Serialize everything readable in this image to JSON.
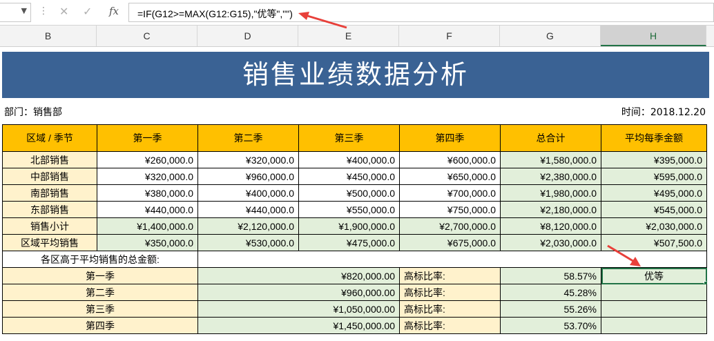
{
  "formula_bar": {
    "formula": "=IF(G12>=MAX(G12:G15),\"优等\",\"\")",
    "fx_label": "fx"
  },
  "columns": [
    "B",
    "C",
    "D",
    "E",
    "F",
    "G",
    "H"
  ],
  "sheet": {
    "title": "销售业绩数据分析",
    "department": "部门：销售部",
    "time": "时间：2018.12.20",
    "headers": [
      "区域 / 季节",
      "第一季",
      "第二季",
      "第三季",
      "第四季",
      "总合计",
      "平均每季金额"
    ],
    "rows": [
      [
        "北部销售",
        "¥260,000.0",
        "¥320,000.0",
        "¥400,000.0",
        "¥600,000.0",
        "¥1,580,000.0",
        "¥395,000.0"
      ],
      [
        "中部销售",
        "¥320,000.0",
        "¥960,000.0",
        "¥450,000.0",
        "¥650,000.0",
        "¥2,380,000.0",
        "¥595,000.0"
      ],
      [
        "南部销售",
        "¥380,000.0",
        "¥400,000.0",
        "¥500,000.0",
        "¥700,000.0",
        "¥1,980,000.0",
        "¥495,000.0"
      ],
      [
        "东部销售",
        "¥440,000.0",
        "¥440,000.0",
        "¥550,000.0",
        "¥750,000.0",
        "¥2,180,000.0",
        "¥545,000.0"
      ],
      [
        "销售小计",
        "¥1,400,000.0",
        "¥2,120,000.0",
        "¥1,900,000.0",
        "¥2,700,000.0",
        "¥8,120,000.0",
        "¥2,030,000.0"
      ],
      [
        "区域平均销售",
        "¥350,000.0",
        "¥530,000.0",
        "¥475,000.0",
        "¥675,000.0",
        "¥2,030,000.0",
        "¥507,500.0"
      ]
    ],
    "above_avg_label": "各区高于平均销售的总金额:",
    "quarters": [
      {
        "name": "第一季",
        "amount": "¥820,000.00",
        "ratio_label": "高标比率:",
        "ratio": "58.57%",
        "grade": "优等"
      },
      {
        "name": "第二季",
        "amount": "¥960,000.00",
        "ratio_label": "高标比率:",
        "ratio": "45.28%",
        "grade": ""
      },
      {
        "name": "第三季",
        "amount": "¥1,050,000.00",
        "ratio_label": "高标比率:",
        "ratio": "55.26%",
        "grade": ""
      },
      {
        "name": "第四季",
        "amount": "¥1,450,000.00",
        "ratio_label": "高标比率:",
        "ratio": "53.70%",
        "grade": ""
      }
    ]
  },
  "colors": {
    "title_bg": "#3a6294",
    "header_bg": "#ffc000",
    "label_bg": "#fff2cc",
    "calc_bg": "#e2efda",
    "arrow": "#e8403a"
  }
}
